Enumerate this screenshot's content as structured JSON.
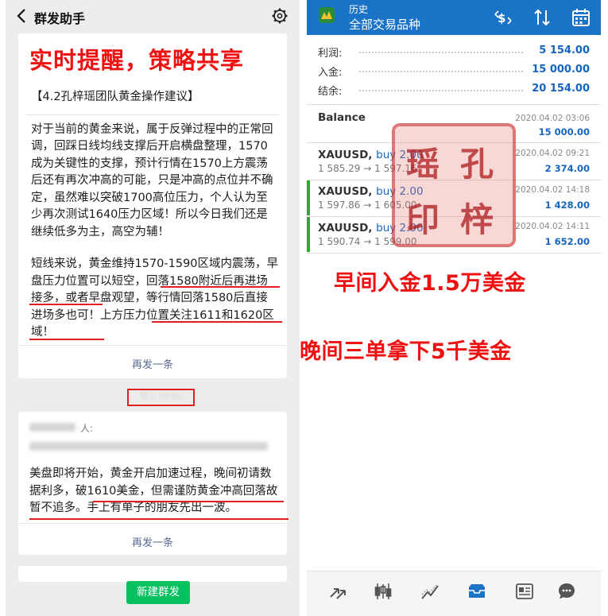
{
  "left_panel": {
    "header": {
      "title": "群发助手"
    },
    "overlay_heading": "实时提醒，策略共享",
    "message1": {
      "title": "【4.2孔梓瑶团队黄金操作建议】",
      "paragraph1": "对于当前的黄金来说，属于反弹过程中的正常回调，回踩日线均线支撑后开启横盘整理，1570成为关键性的支撑，预计行情在1570上方震荡后还有再次冲高的可能，只是冲高的点位并不确定，虽然难以突破1700高位压力，个人认为至少再次测试1640压力区域！所以今日我们还是继续低多为主，高空为辅！",
      "paragraph2": "短线来说，黄金维持1570-1590区域内震荡，早盘压力位置可以短空，回落1580附近后再进场接多，或者早盘观望，等行情回落1580后直接进场多也可！上方压力位置关注1611和1620区域！",
      "resend": "再发一条"
    },
    "time_separator": "晚上 20:50",
    "message2": {
      "to_label": "人:",
      "text": "美盘即将开始，黄金开启加速过程，晚间初请数据利多，破1610美金，但需谨防黄金冲高回落故暂不追多。手上有单子的朋友先出一波。",
      "resend": "再发一条"
    },
    "new_group_button": "新建群发",
    "colors": {
      "accent_red": "#e02020",
      "wechat_green": "#07c160",
      "link_blue": "#576b95"
    }
  },
  "right_panel": {
    "header": {
      "subtitle": "历史",
      "title": "全部交易品种"
    },
    "summary": [
      {
        "label": "利润:",
        "value": "5 154.00"
      },
      {
        "label": "入金:",
        "value": "15 000.00"
      },
      {
        "label": "结余:",
        "value": "20 154.00"
      }
    ],
    "balance": {
      "label": "Balance",
      "time": "2020.04.02 03:06",
      "amount": "15 000.00"
    },
    "trades": [
      {
        "symbol": "XAUUSD,",
        "direction": "buy 2.00",
        "prices": "1 585.29 → 1 597.16",
        "time": "2020.04.02 09:21",
        "profit": "2 374.00",
        "marker": false
      },
      {
        "symbol": "XAUUSD,",
        "direction": "buy 2.00",
        "prices": "1 597.86 → 1 605.00",
        "time": "2020.04.02 14:18",
        "profit": "1 428.00",
        "marker": true
      },
      {
        "symbol": "XAUUSD,",
        "direction": "buy 2.00",
        "prices": "1 590.74 → 1 599.00",
        "time": "2020.04.02 14:11",
        "profit": "1 652.00",
        "marker": true
      }
    ],
    "stamp_text": [
      "孔",
      "梓",
      "瑶",
      "印"
    ],
    "overlay_text1": "早间入金1.5万美金",
    "overlay_text2": "晚间三单拿下5千美金",
    "colors": {
      "header_blue": "#1a73c6",
      "value_blue": "#1565c0",
      "marker_green": "#2eaa2e"
    },
    "nav_icons": [
      "trade-icon",
      "chart-icon",
      "analytics-icon",
      "history-icon",
      "news-icon",
      "chat-icon"
    ]
  }
}
